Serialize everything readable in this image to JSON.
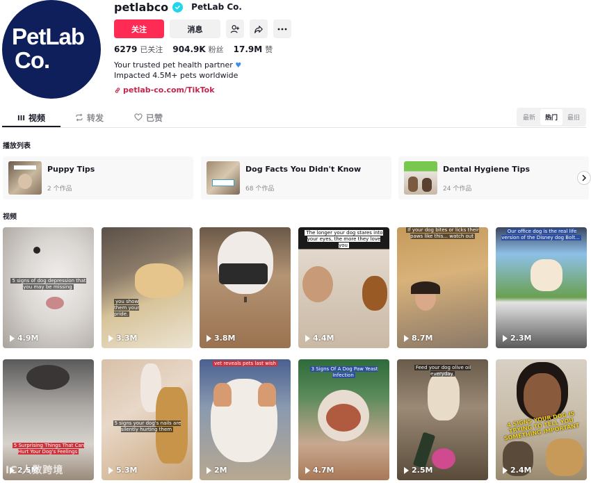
{
  "profile": {
    "avatar_text_line1": "PetLab",
    "avatar_text_line2": "Co.",
    "username": "petlabco",
    "nickname": "PetLab Co.",
    "follow_label": "关注",
    "message_label": "消息",
    "stats": {
      "following_count": "6279",
      "following_label": "已关注",
      "followers_count": "904.9K",
      "followers_label": "粉丝",
      "likes_count": "17.9M",
      "likes_label": "赞"
    },
    "bio_line1": "Your trusted pet health partner",
    "bio_line2": "Impacted 4.5M+ pets worldwide",
    "link": "petlab-co.com/TikTok"
  },
  "tabs": [
    {
      "label": "视频",
      "icon": "grid-icon"
    },
    {
      "label": "转发",
      "icon": "repost-icon"
    },
    {
      "label": "已赞",
      "icon": "heart-outline-icon"
    }
  ],
  "sort": {
    "newest": "最新",
    "popular": "热门",
    "oldest": "最旧"
  },
  "playlists_title": "播放列表",
  "playlists": [
    {
      "name": "Puppy Tips",
      "count": "2 个作品"
    },
    {
      "name": "Dog Facts You Didn't Know",
      "count": "68 个作品"
    },
    {
      "name": "Dental Hygiene Tips",
      "count": "24 个作品"
    }
  ],
  "videos_title": "视频",
  "videos": [
    {
      "views": "4.9M",
      "caption": "5 signs of dog depression that you may be missing"
    },
    {
      "views": "3.3M",
      "caption": "you show them your pride."
    },
    {
      "views": "3.8M",
      "caption": ""
    },
    {
      "views": "4.4M",
      "caption": "The longer your dog stares into your eyes, the more they love you"
    },
    {
      "views": "8.7M",
      "caption": "If your dog bites or licks their paws like this... watch out"
    },
    {
      "views": "2.3M",
      "caption": "Our office dog is the real life version of the Disney dog Bolt..."
    },
    {
      "views": "2.5M",
      "caption": "5 Surprising Things That Can Hurt Your Dog's Feelings"
    },
    {
      "views": "5.3M",
      "caption": "5 signs your dog's nails are silently hurting them"
    },
    {
      "views": "2M",
      "caption": "vet reveals pets last wish"
    },
    {
      "views": "4.7M",
      "caption": "3 Signs Of A Dog Paw Yeast Infection"
    },
    {
      "views": "2.5M",
      "caption": "Feed your dog olive oil everyday"
    },
    {
      "views": "2.4M",
      "caption": "4 SIGNS YOUR DOG IS TRYING TO TELL YOU SOMETHING IMPORTANT"
    }
  ],
  "watermark": "IC 人数跨境",
  "colors": {
    "follow_button": "#fe2c55",
    "avatar_bg": "#0f1f5c",
    "link": "#c4234a",
    "verified": "#20d5ec"
  }
}
